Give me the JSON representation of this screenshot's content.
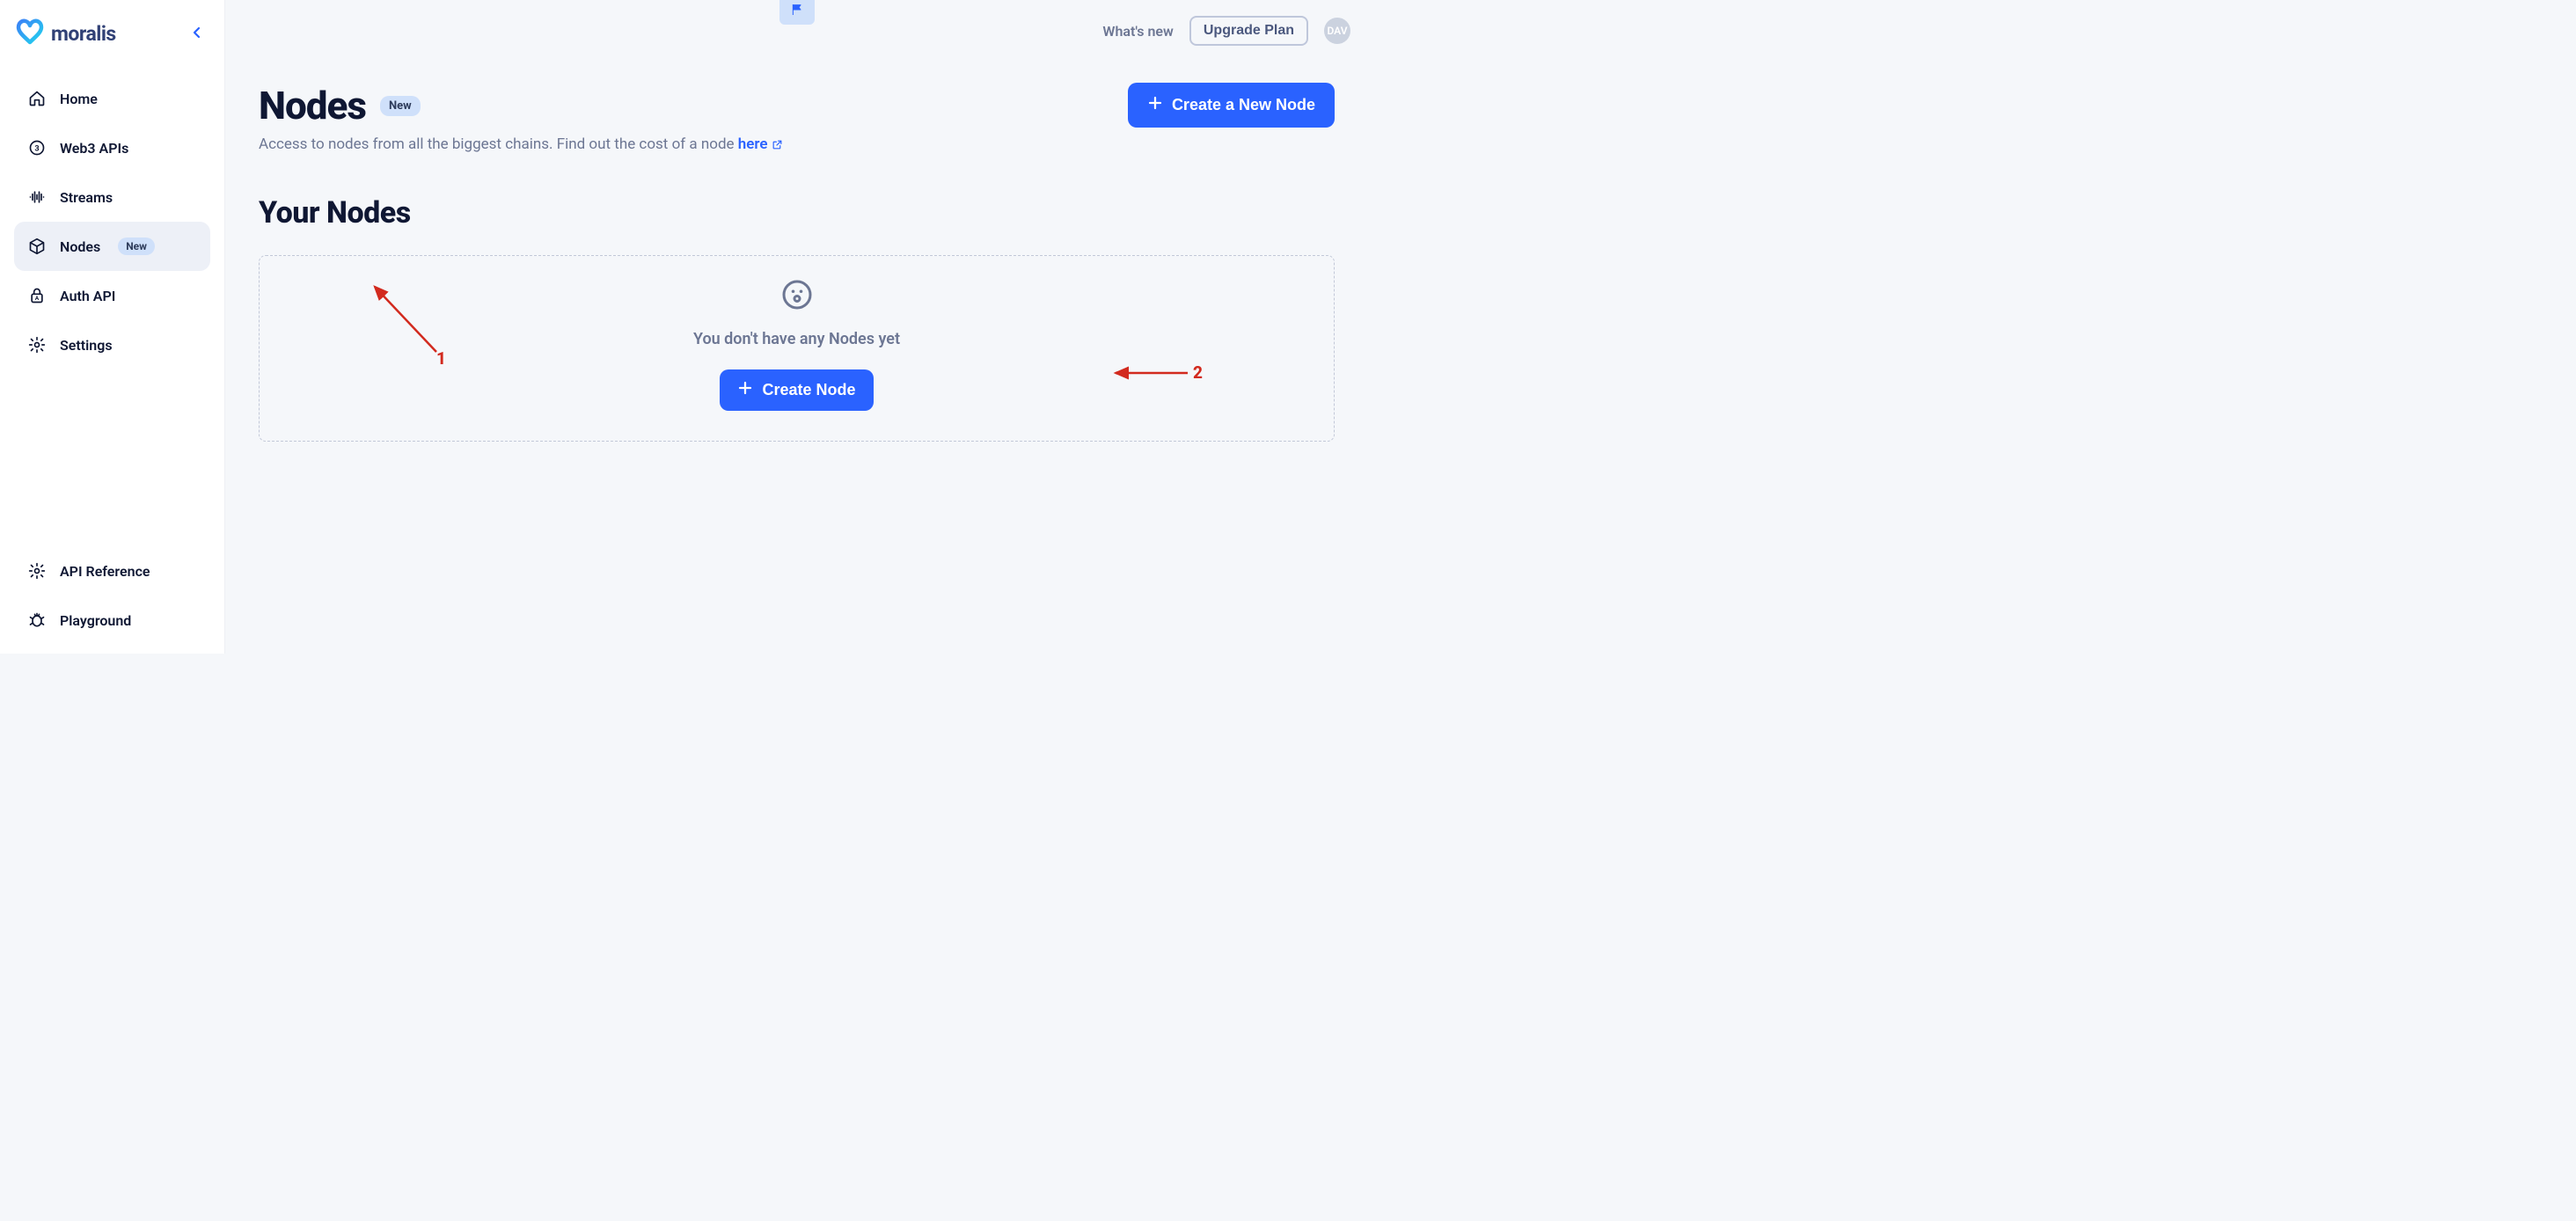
{
  "brand": {
    "name": "moralis"
  },
  "sidebar": {
    "items": [
      {
        "label": "Home"
      },
      {
        "label": "Web3 APIs"
      },
      {
        "label": "Streams"
      },
      {
        "label": "Nodes",
        "badge": "New"
      },
      {
        "label": "Auth API"
      },
      {
        "label": "Settings"
      }
    ],
    "bottom": [
      {
        "label": "API Reference"
      },
      {
        "label": "Playground"
      }
    ]
  },
  "topbar": {
    "whats_new": "What's new",
    "upgrade": "Upgrade Plan",
    "avatar": "DAV"
  },
  "page": {
    "title": "Nodes",
    "title_badge": "New",
    "subtitle_prefix": "Access to nodes from all the biggest chains. Find out the cost of a node ",
    "subtitle_link": "here",
    "create_button": "Create a New Node"
  },
  "section": {
    "title": "Your Nodes",
    "empty_text": "You don't have any Nodes yet",
    "empty_button": "Create Node"
  },
  "annotations": {
    "one": "1",
    "two": "2"
  }
}
